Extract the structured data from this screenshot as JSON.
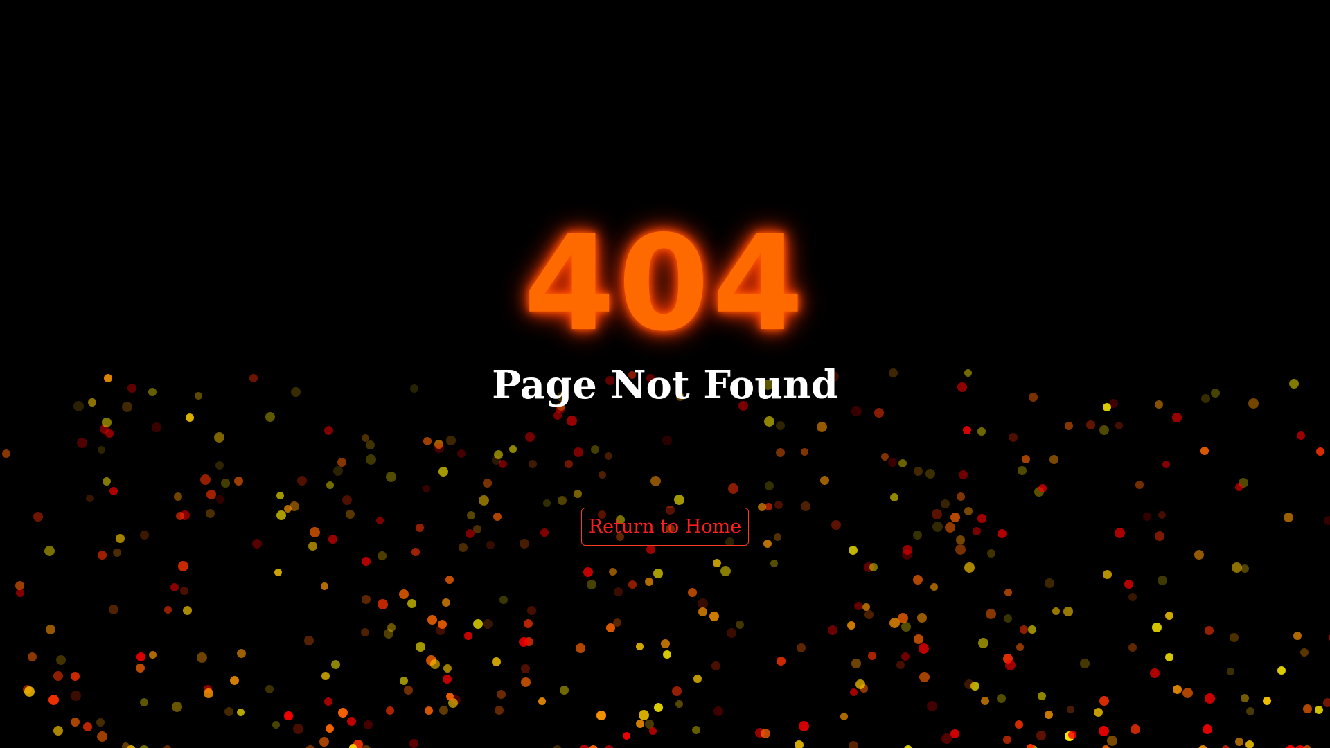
{
  "error": {
    "code": "404",
    "title": "Page Not Found"
  },
  "actions": {
    "home_label": "Return to Home"
  },
  "colors": {
    "background": "#000000",
    "code_glow": "#ff6a00",
    "title": "#ffffff",
    "button_accent": "#ff1e1e",
    "particle_palette": [
      "#ff0000",
      "#ff3300",
      "#ff6600",
      "#ff9900",
      "#ffcc00",
      "#ffee00"
    ]
  }
}
